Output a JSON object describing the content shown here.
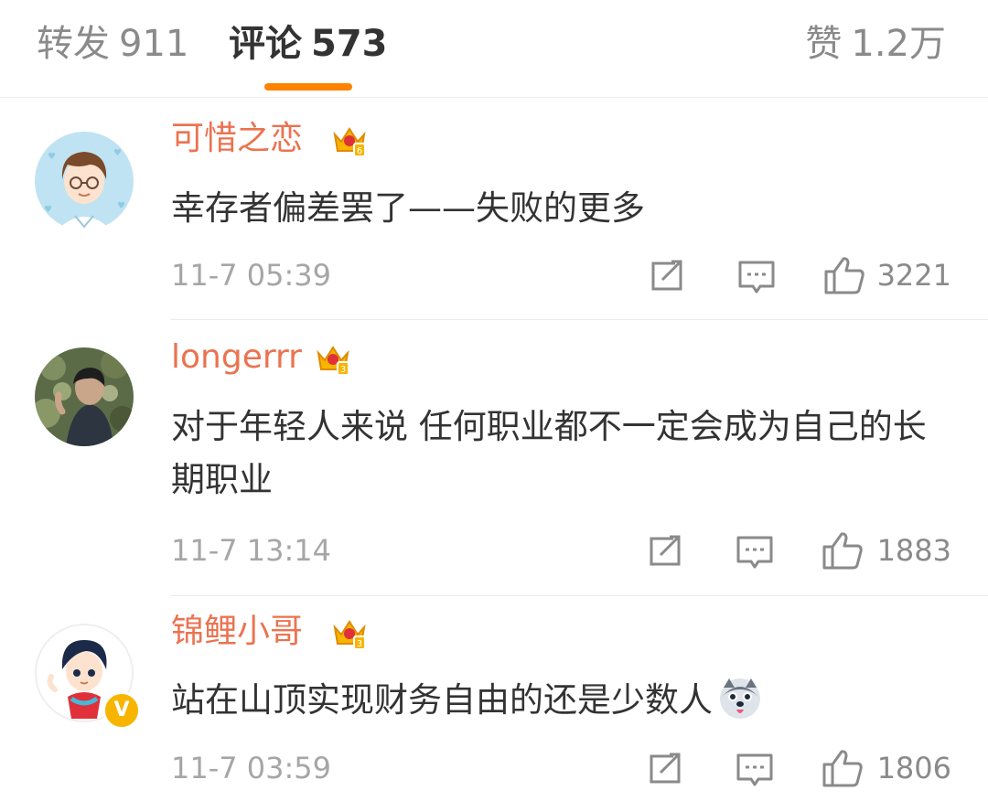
{
  "tabs": [
    {
      "label": "转发",
      "count": "911"
    },
    {
      "label": "评论",
      "count": "573"
    },
    {
      "label": "赞",
      "count": "1.2万"
    }
  ],
  "active_tab": "评论",
  "accent_color": "#ff8200",
  "username_color": "#eb7350",
  "comments": [
    {
      "username": "可惜之恋",
      "badge_icon": "vip-crown-icon",
      "text": "幸存者偏差罢了——失败的更多",
      "time": "11-7 05:39",
      "likes": "3221"
    },
    {
      "username": "longerrr",
      "badge_icon": "vip-crown-icon",
      "text": "对于年轻人来说 任何职业都不一定会成为自己的长期职业",
      "time": "11-7 13:14",
      "likes": "1883"
    },
    {
      "username": "锦鲤小哥",
      "badge_icon": "vip-crown-icon",
      "verified_badge": "V",
      "text": "站在山顶实现财务自由的还是少数人",
      "emoji_icon": "husky-emoji-icon",
      "time": "11-7 03:59",
      "likes": "1806"
    }
  ],
  "action_icons": [
    "repost-icon",
    "comment-icon",
    "like-icon"
  ]
}
